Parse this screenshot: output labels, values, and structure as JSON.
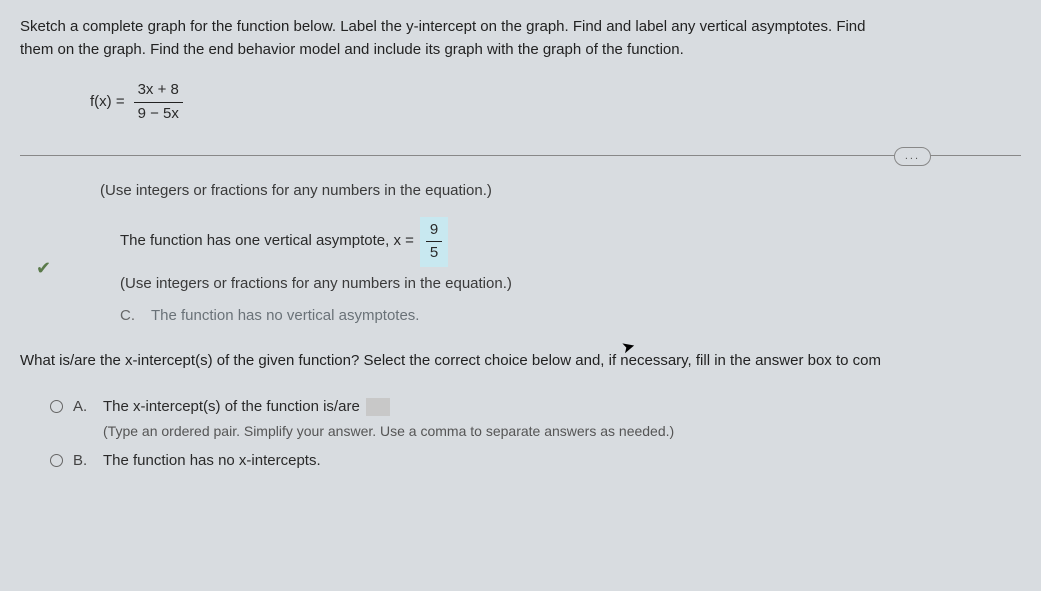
{
  "prompt": {
    "line1": "Sketch a complete graph for the function below. Label the y-intercept on the graph. Find and label any vertical asymptotes. Find",
    "line2": "them on the graph. Find the end behavior model and include its graph with the graph of the function."
  },
  "equation": {
    "lhs": "f(x) =",
    "numerator": "3x + 8",
    "denominator": "9 − 5x"
  },
  "hint1": "(Use integers or fractions for any numbers in the equation.)",
  "optionB": {
    "prefix": "The function has one vertical asymptote,  x =",
    "ans_num": "9",
    "ans_den": "5"
  },
  "hint2": "(Use integers or fractions for any numbers in the equation.)",
  "optionC": {
    "letter": "C.",
    "text": "The function has no vertical asymptotes."
  },
  "question2": "What is/are the x-intercept(s) of the given function? Select the correct choice below and, if necessary, fill in the answer box to com",
  "mcA": {
    "letter": "A.",
    "text": "The x-intercept(s) of the function is/are",
    "hint": "(Type an ordered pair. Simplify your answer. Use a comma to separate answers as needed.)"
  },
  "mcB": {
    "letter": "B.",
    "text": "The function has no x-intercepts."
  },
  "ellipsis": "..."
}
